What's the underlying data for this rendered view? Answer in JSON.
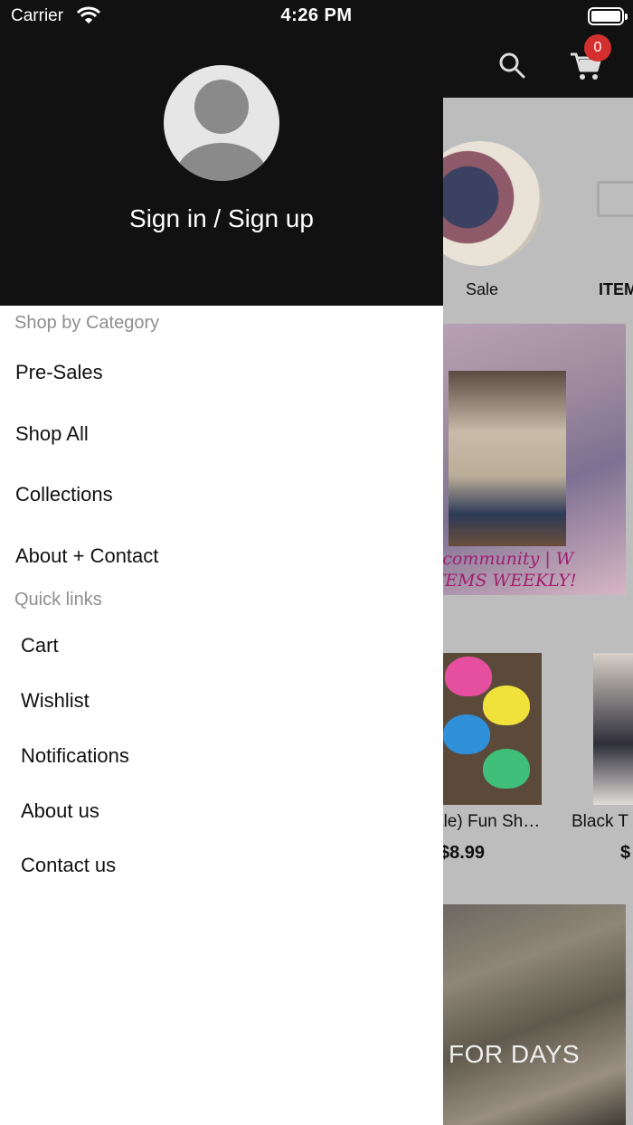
{
  "status_bar": {
    "carrier": "Carrier",
    "time": "4:26 PM"
  },
  "header": {
    "cart_count": "0"
  },
  "background": {
    "categories": [
      {
        "label": "Sale"
      },
      {
        "label": "ITEM"
      }
    ],
    "banner1_text": "e community | W ITEMS WEEKLY!",
    "products": [
      {
        "name": "ale) Fun Sh…",
        "price": "$8.99"
      },
      {
        "name": "Black T",
        "price": "$"
      }
    ],
    "banner2_text": "FOR DAYS"
  },
  "drawer": {
    "signin_label": "Sign in / Sign up",
    "shop_by_category": {
      "title": "Shop by Category",
      "items": [
        {
          "label": "Pre-Sales"
        },
        {
          "label": "Shop All"
        },
        {
          "label": "Collections"
        },
        {
          "label": "About + Contact"
        }
      ]
    },
    "quick_links": {
      "title": "Quick links",
      "items": [
        {
          "label": "Cart"
        },
        {
          "label": "Wishlist"
        },
        {
          "label": "Notifications"
        },
        {
          "label": "About us"
        },
        {
          "label": "Contact us"
        }
      ]
    }
  },
  "colors": {
    "header_bg": "#111111",
    "badge": "#d32f2f",
    "section_title": "#8e8e8e",
    "promo_text": "#a0206e"
  },
  "icons": {
    "search": "search-icon",
    "cart": "cart-icon",
    "avatar": "user-placeholder-icon",
    "wifi": "wifi-icon",
    "battery": "battery-icon"
  }
}
